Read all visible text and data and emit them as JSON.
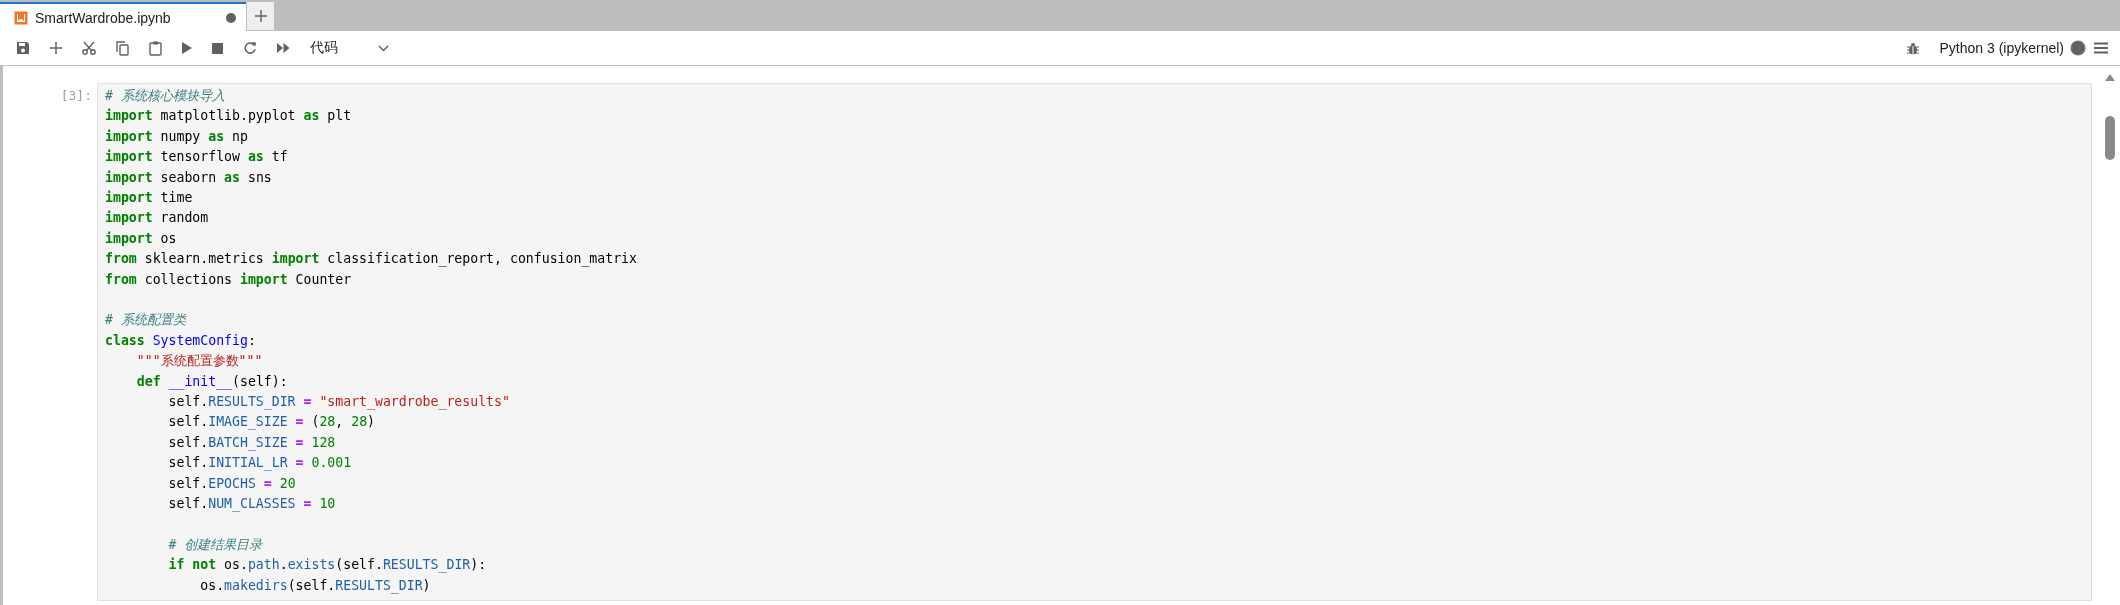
{
  "tabs": [
    {
      "title": "SmartWardrobe.ipynb",
      "selected": true,
      "unsaved": true
    }
  ],
  "toolbar": {
    "cell_type": "代码",
    "kernel": "Python 3 (ipykernel)",
    "kernel_busy": true
  },
  "cells": [
    {
      "prompt": "[3]:",
      "lines": [
        {
          "kind": "code",
          "tokens": [
            {
              "kind": "com",
              "text": "# 系统核心模块导入"
            }
          ]
        },
        {
          "kind": "code",
          "tokens": [
            {
              "kind": "kw",
              "text": "import"
            },
            {
              "kind": "name",
              "text": " matplotlib.pyplot "
            },
            {
              "kind": "kw",
              "text": "as"
            },
            {
              "kind": "name",
              "text": " plt"
            }
          ]
        },
        {
          "kind": "code",
          "tokens": [
            {
              "kind": "kw",
              "text": "import"
            },
            {
              "kind": "name",
              "text": " numpy "
            },
            {
              "kind": "kw",
              "text": "as"
            },
            {
              "kind": "name",
              "text": " np"
            }
          ]
        },
        {
          "kind": "code",
          "tokens": [
            {
              "kind": "kw",
              "text": "import"
            },
            {
              "kind": "name",
              "text": " tensorflow "
            },
            {
              "kind": "kw",
              "text": "as"
            },
            {
              "kind": "name",
              "text": " tf"
            }
          ]
        },
        {
          "kind": "code",
          "tokens": [
            {
              "kind": "kw",
              "text": "import"
            },
            {
              "kind": "name",
              "text": " seaborn "
            },
            {
              "kind": "kw",
              "text": "as"
            },
            {
              "kind": "name",
              "text": " sns"
            }
          ]
        },
        {
          "kind": "code",
          "tokens": [
            {
              "kind": "kw",
              "text": "import"
            },
            {
              "kind": "name",
              "text": " time"
            }
          ]
        },
        {
          "kind": "code",
          "tokens": [
            {
              "kind": "kw",
              "text": "import"
            },
            {
              "kind": "name",
              "text": " random"
            }
          ]
        },
        {
          "kind": "code",
          "tokens": [
            {
              "kind": "kw",
              "text": "import"
            },
            {
              "kind": "name",
              "text": " os"
            }
          ]
        },
        {
          "kind": "code",
          "tokens": [
            {
              "kind": "kw",
              "text": "from"
            },
            {
              "kind": "name",
              "text": " sklearn.metrics "
            },
            {
              "kind": "kw",
              "text": "import"
            },
            {
              "kind": "name",
              "text": " classification_report, confusion_matrix"
            }
          ]
        },
        {
          "kind": "code",
          "tokens": [
            {
              "kind": "kw",
              "text": "from"
            },
            {
              "kind": "name",
              "text": " collections "
            },
            {
              "kind": "kw",
              "text": "import"
            },
            {
              "kind": "name",
              "text": " Counter"
            }
          ]
        },
        {
          "kind": "blank"
        },
        {
          "kind": "code",
          "tokens": [
            {
              "kind": "com",
              "text": "# 系统配置类"
            }
          ]
        },
        {
          "kind": "code",
          "tokens": [
            {
              "kind": "kw",
              "text": "class "
            },
            {
              "kind": "def",
              "text": "SystemConfig"
            },
            {
              "kind": "name",
              "text": ":"
            }
          ]
        },
        {
          "kind": "code",
          "tokens": [
            {
              "kind": "str",
              "text": "    \"\"\"系统配置参数\"\"\""
            }
          ]
        },
        {
          "kind": "code",
          "tokens": [
            {
              "kind": "kw",
              "text": "    def "
            },
            {
              "kind": "def",
              "text": "__init__"
            },
            {
              "kind": "name",
              "text": "(self):"
            }
          ]
        },
        {
          "kind": "code",
          "tokens": [
            {
              "kind": "name",
              "text": "        self."
            },
            {
              "kind": "attr",
              "text": "RESULTS_DIR"
            },
            {
              "kind": "op",
              "text": " = "
            },
            {
              "kind": "str",
              "text": "\"smart_wardrobe_results\""
            }
          ]
        },
        {
          "kind": "code",
          "tokens": [
            {
              "kind": "name",
              "text": "        self."
            },
            {
              "kind": "attr",
              "text": "IMAGE_SIZE"
            },
            {
              "kind": "op",
              "text": " = "
            },
            {
              "kind": "name",
              "text": "("
            },
            {
              "kind": "num",
              "text": "28"
            },
            {
              "kind": "name",
              "text": ", "
            },
            {
              "kind": "num",
              "text": "28"
            },
            {
              "kind": "name",
              "text": ")"
            }
          ]
        },
        {
          "kind": "code",
          "tokens": [
            {
              "kind": "name",
              "text": "        self."
            },
            {
              "kind": "attr",
              "text": "BATCH_SIZE"
            },
            {
              "kind": "op",
              "text": " = "
            },
            {
              "kind": "num",
              "text": "128"
            }
          ]
        },
        {
          "kind": "code",
          "tokens": [
            {
              "kind": "name",
              "text": "        self."
            },
            {
              "kind": "attr",
              "text": "INITIAL_LR"
            },
            {
              "kind": "op",
              "text": " = "
            },
            {
              "kind": "num",
              "text": "0.001"
            }
          ]
        },
        {
          "kind": "code",
          "tokens": [
            {
              "kind": "name",
              "text": "        self."
            },
            {
              "kind": "attr",
              "text": "EPOCHS"
            },
            {
              "kind": "op",
              "text": " = "
            },
            {
              "kind": "num",
              "text": "20"
            }
          ]
        },
        {
          "kind": "code",
          "tokens": [
            {
              "kind": "name",
              "text": "        self."
            },
            {
              "kind": "attr",
              "text": "NUM_CLASSES"
            },
            {
              "kind": "op",
              "text": " = "
            },
            {
              "kind": "num",
              "text": "10"
            }
          ]
        },
        {
          "kind": "blank"
        },
        {
          "kind": "code",
          "tokens": [
            {
              "kind": "com",
              "text": "        # 创建结果目录"
            }
          ]
        },
        {
          "kind": "code",
          "tokens": [
            {
              "kind": "kw",
              "text": "        if not"
            },
            {
              "kind": "name",
              "text": " os."
            },
            {
              "kind": "attr",
              "text": "path"
            },
            {
              "kind": "name",
              "text": "."
            },
            {
              "kind": "attr",
              "text": "exists"
            },
            {
              "kind": "name",
              "text": "(self."
            },
            {
              "kind": "attr",
              "text": "RESULTS_DIR"
            },
            {
              "kind": "name",
              "text": "):"
            }
          ]
        },
        {
          "kind": "code",
          "tokens": [
            {
              "kind": "name",
              "text": "            os."
            },
            {
              "kind": "attr",
              "text": "makedirs"
            },
            {
              "kind": "name",
              "text": "(self."
            },
            {
              "kind": "attr",
              "text": "RESULTS_DIR"
            },
            {
              "kind": "name",
              "text": ")"
            }
          ]
        }
      ]
    }
  ]
}
